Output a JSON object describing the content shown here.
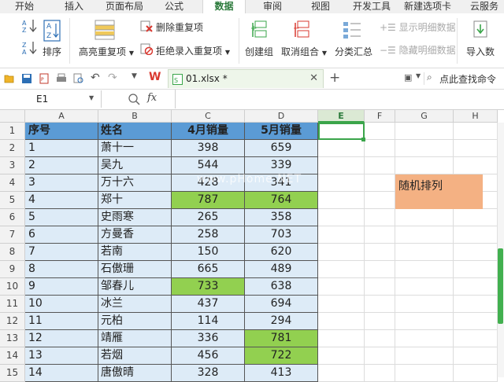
{
  "ribbon_tabs": [
    "开始",
    "插入",
    "页面布局",
    "公式",
    "数据",
    "审阅",
    "视图",
    "开发工具",
    "新建选项卡",
    "云服务"
  ],
  "active_tab": "数据",
  "ribbon": {
    "sort_label": "排序",
    "highlight_dup_label": "高亮重复项",
    "remove_dup_label": "删除重复项",
    "reject_dup_label": "拒绝录入重复项",
    "create_group_label": "创建组",
    "ungroup_label": "取消组合",
    "subtotal_label": "分类汇总",
    "show_detail_label": "显示明细数据",
    "hide_detail_label": "隐藏明细数据",
    "import_label": "导入数"
  },
  "toolbar": {
    "doc_name": "01.xlsx *",
    "search_cmd_label": "点此查找命令"
  },
  "formula_bar": {
    "cell_ref": "E1",
    "fx_label": "fx",
    "formula": ""
  },
  "columns": [
    "A",
    "B",
    "C",
    "D",
    "E",
    "F",
    "G",
    "H"
  ],
  "row_numbers": [
    "1",
    "2",
    "3",
    "4",
    "5",
    "6",
    "7",
    "8",
    "9",
    "10",
    "11",
    "12",
    "13",
    "14",
    "15"
  ],
  "table": {
    "headers": [
      "序号",
      "姓名",
      "4月销量",
      "5月销量"
    ],
    "rows": [
      [
        "1",
        "萧十一",
        "398",
        "659"
      ],
      [
        "2",
        "吴九",
        "544",
        "339"
      ],
      [
        "3",
        "万十六",
        "428",
        "341"
      ],
      [
        "4",
        "郑十",
        "787",
        "764"
      ],
      [
        "5",
        "史雨寒",
        "265",
        "358"
      ],
      [
        "6",
        "方曼香",
        "258",
        "703"
      ],
      [
        "7",
        "若南",
        "150",
        "620"
      ],
      [
        "8",
        "石傲珊",
        "665",
        "489"
      ],
      [
        "9",
        "邹春儿",
        "733",
        "638"
      ],
      [
        "10",
        "冰兰",
        "437",
        "694"
      ],
      [
        "11",
        "元柏",
        "114",
        "294"
      ],
      [
        "12",
        "靖雁",
        "336",
        "781"
      ],
      [
        "13",
        "若烟",
        "456",
        "722"
      ],
      [
        "14",
        "唐傲晴",
        "328",
        "413"
      ]
    ],
    "highlighted": {
      "c": [
        4,
        9
      ],
      "d": [
        4,
        12,
        13
      ]
    }
  },
  "side_label": "随机排列",
  "watermark": "www.pHome.NET",
  "colors": {
    "header_fill": "#5b9bd5",
    "body_fill": "#ddebf7",
    "highlight_fill": "#92d050",
    "note_fill": "#f4b183",
    "accent": "#3aa54a"
  }
}
